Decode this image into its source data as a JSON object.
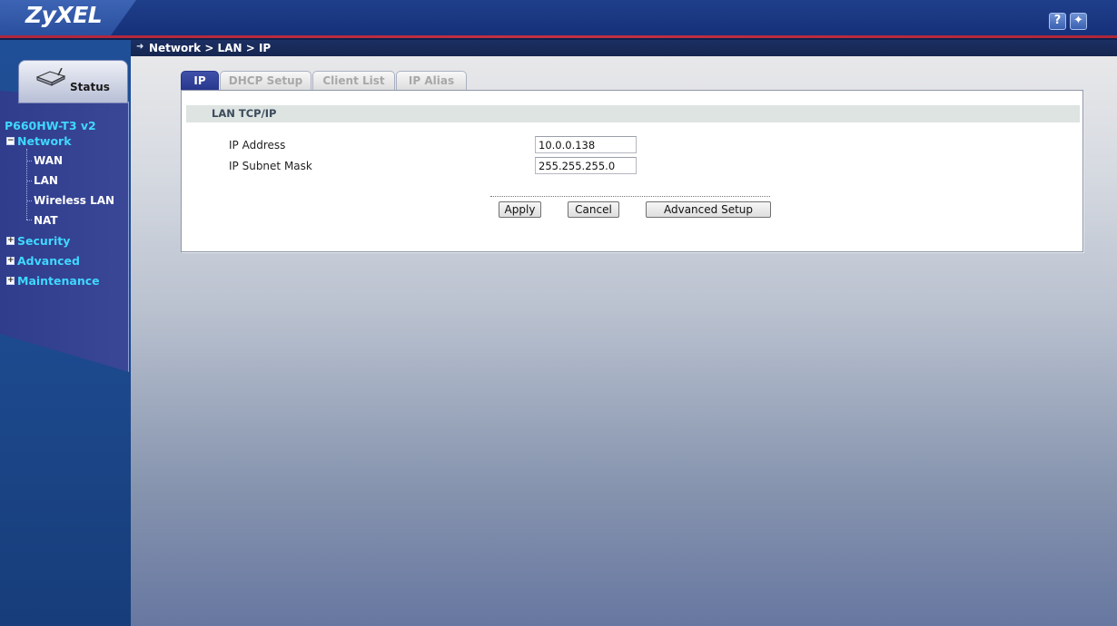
{
  "header": {
    "logo": "ZyXEL",
    "help_icon": "question-icon",
    "wizard_icon": "wizard-icon",
    "help_glyph": "?",
    "wizard_glyph": "✦"
  },
  "breadcrumb": "Network > LAN > IP",
  "sidebar": {
    "status_label": "Status",
    "device_name": "P660HW-T3 v2",
    "sections": [
      {
        "label": "Network",
        "expanded": true,
        "toggle": "−"
      },
      {
        "label": "Security",
        "expanded": false,
        "toggle": "+"
      },
      {
        "label": "Advanced",
        "expanded": false,
        "toggle": "+"
      },
      {
        "label": "Maintenance",
        "expanded": false,
        "toggle": "+"
      }
    ],
    "network_items": [
      "WAN",
      "LAN",
      "Wireless LAN",
      "NAT"
    ]
  },
  "tabs": [
    {
      "label": "IP",
      "active": true
    },
    {
      "label": "DHCP Setup",
      "active": false
    },
    {
      "label": "Client List",
      "active": false
    },
    {
      "label": "IP Alias",
      "active": false
    }
  ],
  "section_title": "LAN TCP/IP",
  "fields": {
    "ip_label": "IP Address",
    "ip_value": "10.0.0.138",
    "mask_label": "IP Subnet Mask",
    "mask_value": "255.255.255.0"
  },
  "buttons": {
    "apply": "Apply",
    "cancel": "Cancel",
    "advanced": "Advanced Setup"
  },
  "colors": {
    "accent_cyan": "#3fd8ff",
    "header_blue": "#1a3680",
    "active_tab": "#27368c",
    "header_red": "#c23043"
  }
}
